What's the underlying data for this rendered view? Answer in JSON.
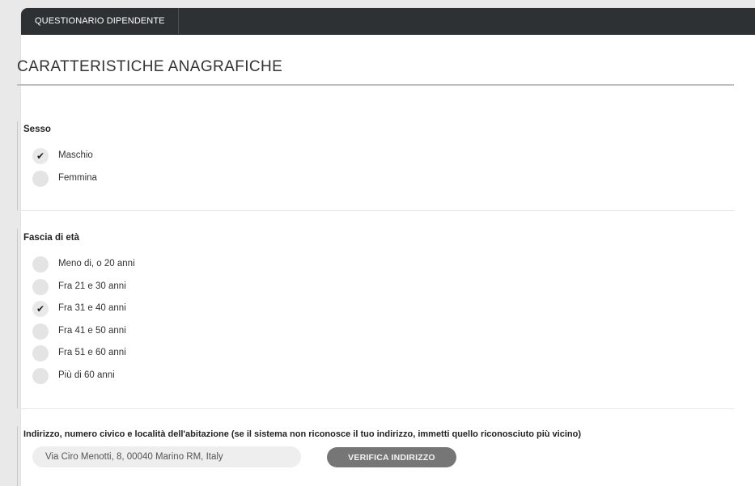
{
  "header": {
    "tab_label": "QUESTIONARIO DIPENDENTE"
  },
  "page": {
    "title": "CARATTERISTICHE ANAGRAFICHE"
  },
  "sesso": {
    "label": "Sesso",
    "options": [
      {
        "label": "Maschio",
        "checked": true
      },
      {
        "label": "Femmina",
        "checked": false
      }
    ]
  },
  "eta": {
    "label": "Fascia di età",
    "options": [
      {
        "label": "Meno di, o 20 anni",
        "checked": false
      },
      {
        "label": "Fra 21 e 30 anni",
        "checked": false
      },
      {
        "label": "Fra 31 e 40 anni",
        "checked": true
      },
      {
        "label": "Fra 41 e 50 anni",
        "checked": false
      },
      {
        "label": "Fra 51 e 60 anni",
        "checked": false
      },
      {
        "label": "Più di 60 anni",
        "checked": false
      }
    ]
  },
  "indirizzo": {
    "label": "Indirizzo, numero civico e località dell'abitazione (se il sistema non riconosce il tuo indirizzo, immetti quello riconosciuto più vicino)",
    "value": "Via Ciro Menotti, 8, 00040 Marino RM, Italy",
    "button_label": "VERIFICA INDIRIZZO"
  },
  "icons": {
    "check": "checkmark-icon"
  },
  "colors": {
    "topbar": "#2e3133",
    "button": "#767676",
    "input_bg": "#eeeeee"
  }
}
